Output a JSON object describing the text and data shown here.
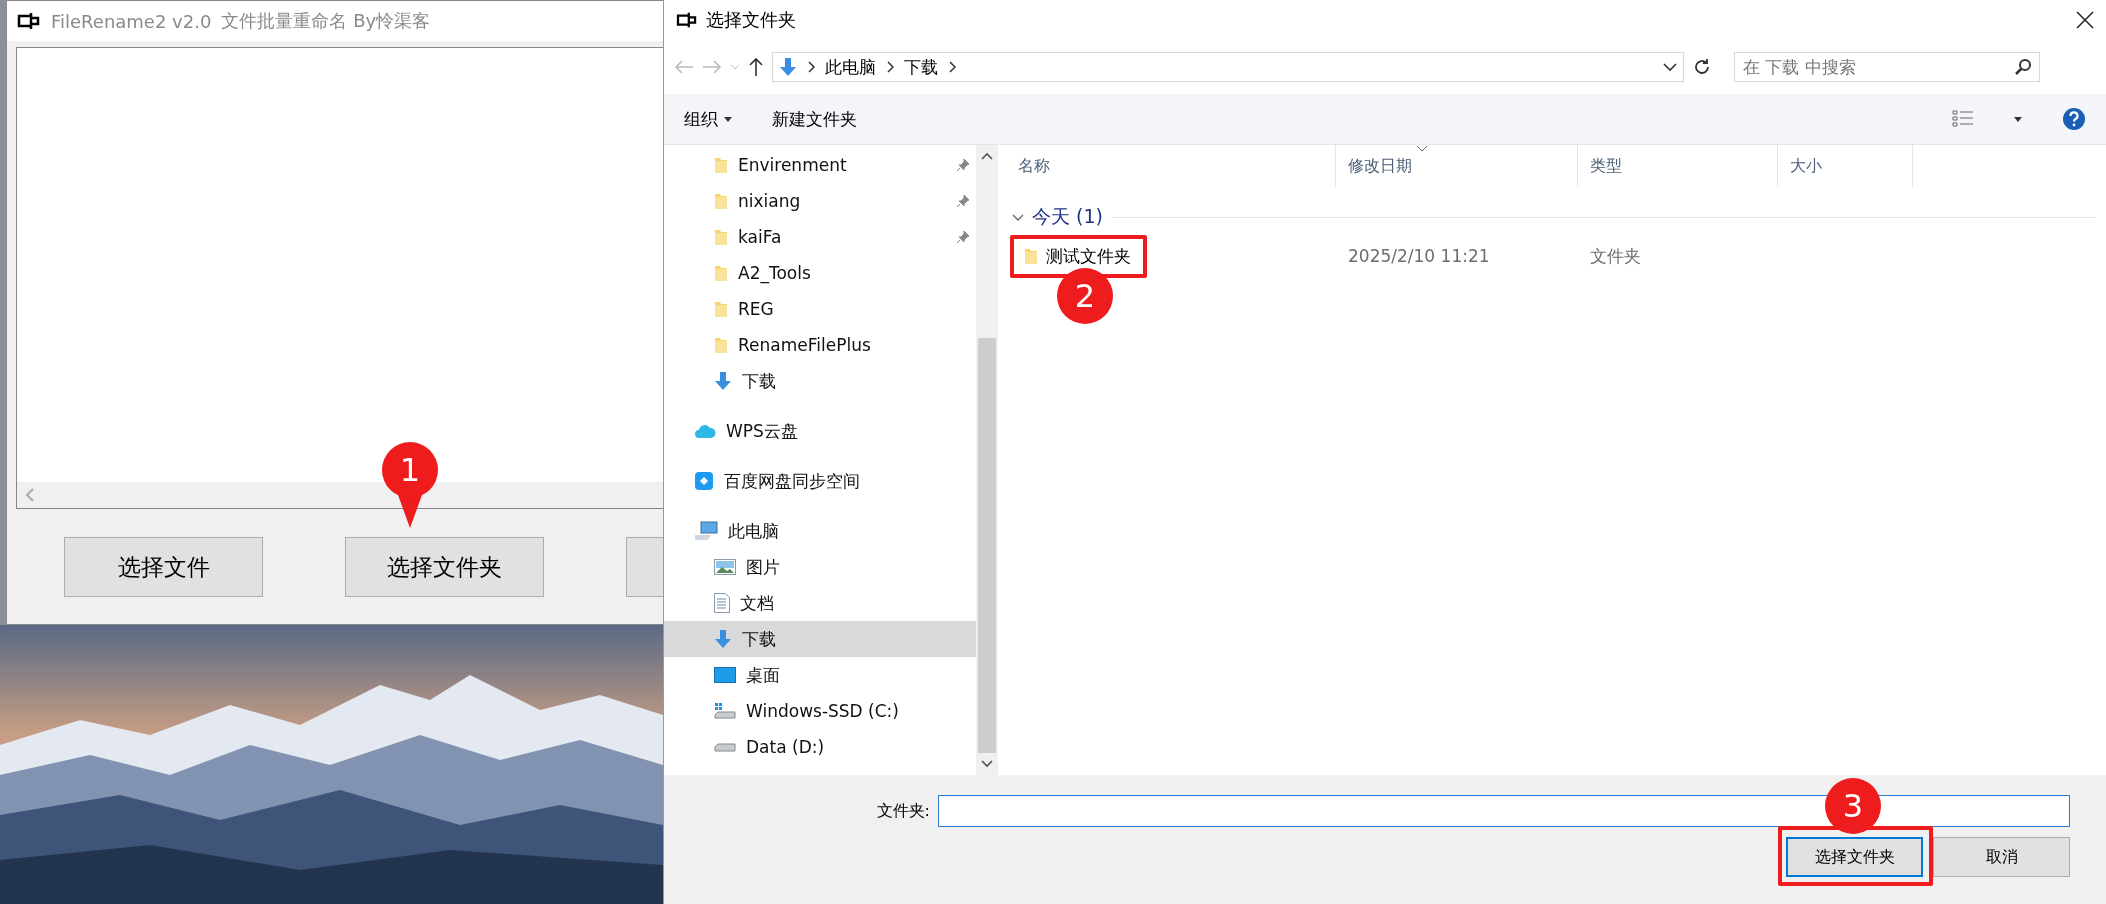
{
  "app_window": {
    "title": "FileRename2 v2.0",
    "subtitle": "文件批量重命名 By怜渠客",
    "buttons": [
      {
        "label": "选择文件"
      },
      {
        "label": "选择文件夹"
      }
    ]
  },
  "dialog": {
    "title": "选择文件夹",
    "address": {
      "segments": [
        "此电脑",
        "下载"
      ]
    },
    "search": {
      "placeholder": "在 下载 中搜索"
    },
    "toolbar": {
      "organize": "组织",
      "new_folder": "新建文件夹"
    },
    "nav": {
      "quick_access": [
        {
          "label": "Envirenment",
          "kind": "folder",
          "pinned": true,
          "selected": false
        },
        {
          "label": "nixiang",
          "kind": "folder",
          "pinned": true,
          "selected": false
        },
        {
          "label": "kaiFa",
          "kind": "folder",
          "pinned": true,
          "selected": false
        },
        {
          "label": "A2_Tools",
          "kind": "folder",
          "pinned": false,
          "selected": false
        },
        {
          "label": "REG",
          "kind": "folder",
          "pinned": false,
          "selected": false
        },
        {
          "label": "RenameFilePlus",
          "kind": "folder",
          "pinned": false,
          "selected": false
        },
        {
          "label": "下载",
          "kind": "download",
          "pinned": false,
          "selected": false
        }
      ],
      "locations": [
        {
          "label": "WPS云盘",
          "kind": "cloud",
          "selected": false
        },
        {
          "label": "百度网盘同步空间",
          "kind": "sync",
          "selected": false
        },
        {
          "label": "此电脑",
          "kind": "computer",
          "selected": false,
          "children": [
            {
              "label": "图片",
              "kind": "pictures",
              "selected": false
            },
            {
              "label": "文档",
              "kind": "documents",
              "selected": false
            },
            {
              "label": "下载",
              "kind": "download",
              "selected": true
            },
            {
              "label": "桌面",
              "kind": "desktop",
              "selected": false
            },
            {
              "label": "Windows-SSD (C:)",
              "kind": "system-drive",
              "selected": false
            },
            {
              "label": "Data (D:)",
              "kind": "drive",
              "selected": false
            }
          ]
        }
      ]
    },
    "columns": [
      {
        "label": "名称",
        "sorted": false
      },
      {
        "label": "修改日期",
        "sorted": true
      },
      {
        "label": "类型",
        "sorted": false
      },
      {
        "label": "大小",
        "sorted": false
      }
    ],
    "groups": [
      {
        "label": "今天 (1)",
        "expanded": true,
        "rows": [
          {
            "name": "测试文件夹",
            "modified": "2025/2/10 11:21",
            "type": "文件夹"
          }
        ]
      }
    ],
    "folder_field": {
      "label": "文件夹:"
    },
    "buttons": [
      {
        "label": "选择文件夹",
        "default": true
      },
      {
        "label": "取消",
        "default": false
      }
    ]
  },
  "annotations": [
    {
      "label": "1"
    },
    {
      "label": "2"
    },
    {
      "label": "3"
    }
  ]
}
